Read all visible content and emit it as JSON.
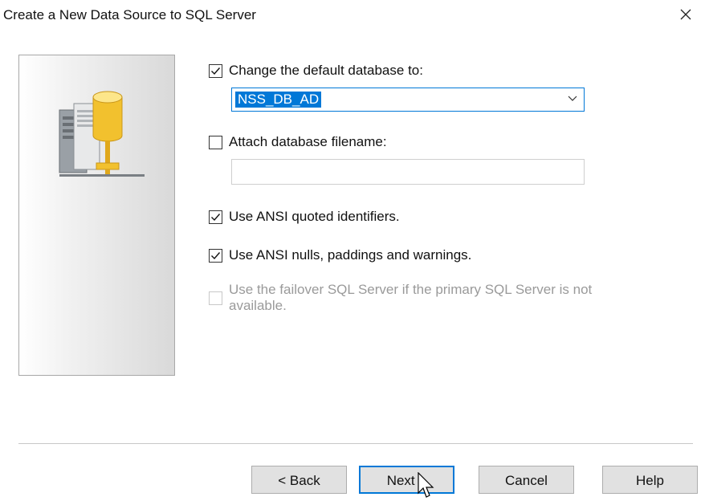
{
  "dialog": {
    "title": "Create a New Data Source to SQL Server"
  },
  "options": {
    "change_default_db": {
      "label": "Change the default database to:",
      "checked": true
    },
    "database_select": {
      "value": "NSS_DB_AD"
    },
    "attach_db_filename": {
      "label": "Attach database filename:",
      "checked": false,
      "value": ""
    },
    "ansi_quoted_identifiers": {
      "label": "Use ANSI quoted identifiers.",
      "checked": true
    },
    "ansi_nulls": {
      "label": "Use ANSI nulls, paddings and warnings.",
      "checked": true
    },
    "failover": {
      "label": "Use the failover SQL Server if the primary SQL Server is not available.",
      "checked": false,
      "enabled": false
    }
  },
  "buttons": {
    "back": "< Back",
    "next": "Next >",
    "cancel": "Cancel",
    "help": "Help"
  },
  "icons": {
    "close": "close-icon",
    "side": "database-server-icon",
    "dropdown": "chevron-down-icon"
  },
  "colors": {
    "accent": "#0078d7",
    "button_face": "#e1e1e1",
    "disabled_text": "#9a9a9a"
  }
}
